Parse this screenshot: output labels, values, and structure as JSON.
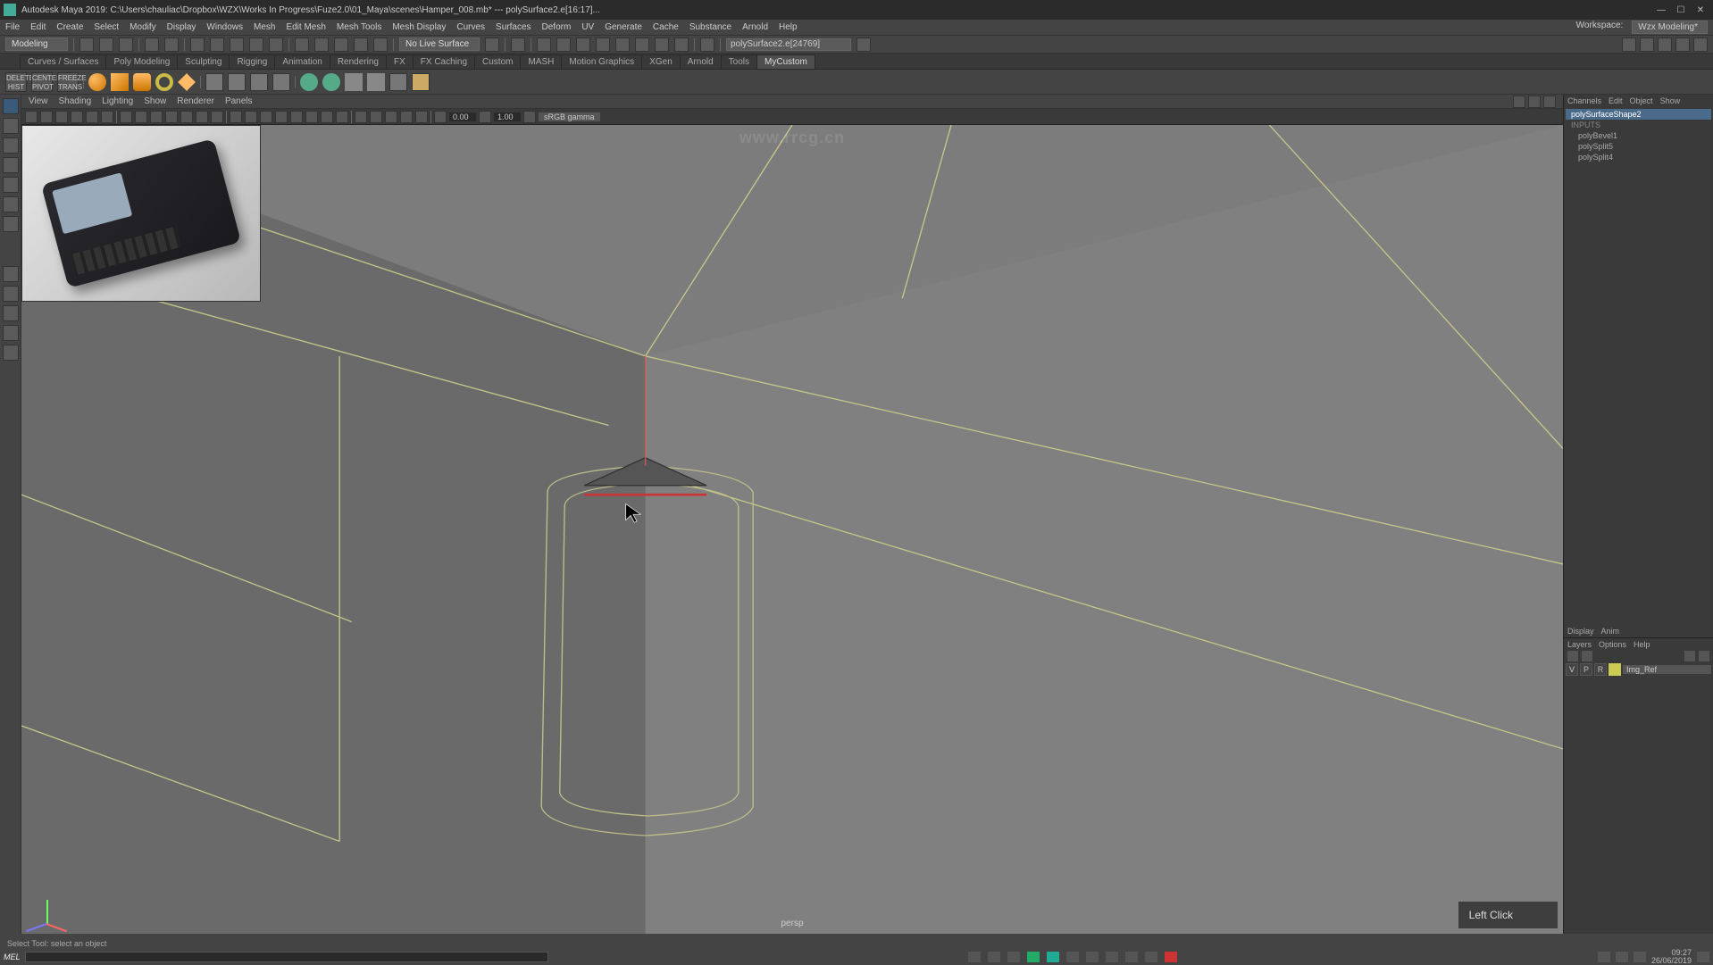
{
  "titlebar": {
    "app": "Autodesk Maya 2019: C:\\Users\\chauliac\\Dropbox\\WZX\\Works In Progress\\Fuze2.0\\01_Maya\\scenes\\Hamper_008.mb* --- polySurface2.e[16:17]..."
  },
  "menubar": {
    "items": [
      "File",
      "Edit",
      "Create",
      "Select",
      "Modify",
      "Display",
      "Windows",
      "Mesh",
      "Edit Mesh",
      "Mesh Tools",
      "Mesh Display",
      "Curves",
      "Surfaces",
      "Deform",
      "UV",
      "Generate",
      "Cache",
      "Substance",
      "Arnold",
      "Help"
    ],
    "right": [
      "Workspace:",
      "Wzx Modeling*"
    ]
  },
  "status": {
    "mode": "Modeling",
    "surface_text": "No Live Surface",
    "search": "polySurface2.e[24769]"
  },
  "shelf_tabs": [
    "Curves / Surfaces",
    "Poly Modeling",
    "Sculpting",
    "Rigging",
    "Animation",
    "Rendering",
    "FX",
    "FX Caching",
    "Custom",
    "MASH",
    "Motion Graphics",
    "XGen",
    "Arnold",
    "Tools",
    "MyCustom"
  ],
  "shelf_active_index": 14,
  "shelf_buttons": [
    "DELETE HIST",
    "CENTER PIVOT",
    "FREEZE TRANS"
  ],
  "panel_menu": [
    "View",
    "Shading",
    "Lighting",
    "Show",
    "Renderer",
    "Panels"
  ],
  "panel_toolbar": {
    "num1": "0.00",
    "num2": "1.00",
    "color_combo": "sRGB gamma"
  },
  "viewport": {
    "camera": "persp",
    "toast": "Left Click"
  },
  "channel_box": {
    "tabs": [
      "Channels",
      "Edit",
      "Object",
      "Show"
    ],
    "items": [
      {
        "name": "polySurfaceShape2",
        "selected": true
      },
      {
        "name": "INPUTS",
        "selected": false,
        "sub": true
      },
      {
        "name": "polyBevel1",
        "selected": false,
        "sub": true
      },
      {
        "name": "polySplit5",
        "selected": false,
        "sub": true
      },
      {
        "name": "polySplit4",
        "selected": false,
        "sub": true
      }
    ]
  },
  "layer_editor": {
    "tabs": [
      "Display",
      "Anim"
    ],
    "menu": [
      "Layers",
      "Options",
      "Help"
    ],
    "layer_name": "Img_Ref",
    "vis": "V",
    "p": "P",
    "r": "R"
  },
  "help_line": "Select Tool: select an object",
  "tray": {
    "time": "09:27",
    "date": "26/06/2019"
  },
  "url_watermark": "www.rrcg.cn"
}
